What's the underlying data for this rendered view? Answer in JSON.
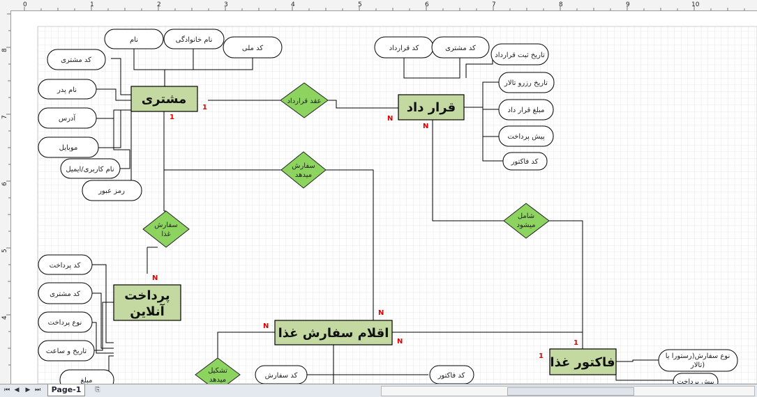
{
  "ruler": {
    "top_marks": [
      "0",
      "1",
      "2",
      "3",
      "4",
      "5",
      "6",
      "7",
      "8",
      "9",
      "10"
    ],
    "left_marks": [
      "8",
      "7",
      "6",
      "5",
      "4"
    ]
  },
  "page_tab": "Page-1",
  "colors": {
    "entity": "#c4d9a2",
    "relationship": "#8dd35f",
    "cardinality": "#e00000",
    "grid": "#e6e6e6"
  },
  "entities": {
    "customer": "مشتری",
    "contract": "قرار داد",
    "online_payment_line1": "پرداخت",
    "online_payment_line2": "آنلاین",
    "order_items": "اقلام سفارش غذا",
    "food_invoice": "فاکتور غذا"
  },
  "relationships": {
    "contract_rel": "عقد قرارداد",
    "order_rel_line1": "سفارش",
    "order_rel_line2": "میدهد",
    "food_order_line1": "سفارش",
    "food_order_line2": "غذا",
    "includes_line1": "شامل",
    "includes_line2": "میشود",
    "forms_line1": "تشکیل",
    "forms_line2": "میدهد"
  },
  "customer_attrs": {
    "name": "نام",
    "family": "نام خانوادگی",
    "national_code": "کد ملی",
    "customer_code": "کد مشتری",
    "father_name": "نام پدر",
    "address": "آدرس",
    "mobile": "موبایل",
    "username": "نام کاربری/ایمیل",
    "password": "رمز عبور"
  },
  "contract_attrs": {
    "contract_code": "کد قرارداد",
    "customer_code": "کد مشتری",
    "reg_date": "تاریخ ثبت قرارداد",
    "hall_date": "تاریخ رزرو تالار",
    "amount": "مبلغ قرار داد",
    "prepayment": "پیش پرداخت",
    "invoice_code": "کد فاکتور"
  },
  "payment_attrs": {
    "payment_code": "کد پرداخت",
    "customer_code": "کد مشتری",
    "payment_type": "نوع پرداخت",
    "datetime": "تاریخ و ساعت",
    "amount": "مبلغ"
  },
  "order_attrs": {
    "order_code": "کد سفارش",
    "invoice_code": "کد فاکتور"
  },
  "invoice_attrs": {
    "order_type_line1": "نوع سفارش(رستورا یا",
    "order_type_line2": "تالار)",
    "prepayment": "پیش پرداخت"
  },
  "cardinalities": {
    "cust_contract": "1",
    "cust_bottom": "1",
    "contract_left": "N",
    "contract_bottom": "N",
    "payment_top": "N",
    "order_top": "N",
    "order_right": "N",
    "order_left": "N",
    "invoice_top": "1",
    "invoice_left": "1"
  }
}
